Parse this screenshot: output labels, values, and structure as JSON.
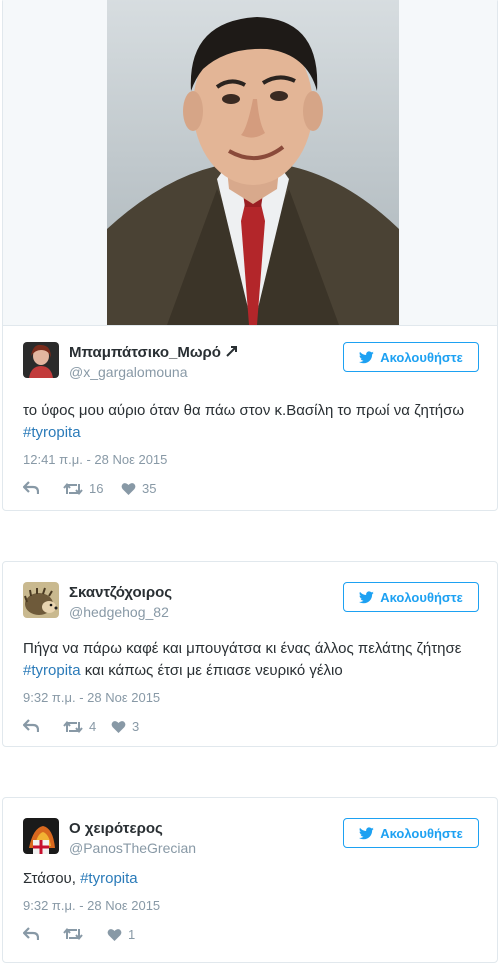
{
  "tweets": [
    {
      "name": "Μπαμπάτσικο_Μωρό",
      "name_icon": "arrow-icon",
      "handle": "@x_gargalomouna",
      "follow_label": "Ακολουθήστε",
      "text": "το ύφος μου αύριο όταν θα πάω στον κ.Βασίλη το πρωί να ζητήσω",
      "hashtag": "#tyropita",
      "text_after": "",
      "time": "12:41 π.μ. - 28 Νοε 2015",
      "retweets": "16",
      "likes": "35"
    },
    {
      "name": "Σκαντζόχοιρος",
      "handle": "@hedgehog_82",
      "follow_label": "Ακολουθήστε",
      "text": "Πήγα να πάρω καφέ και μπουγάτσα κι ένας άλλος πελάτης ζήτησε",
      "hashtag": "#tyropita",
      "text_after": "και κάπως έτσι με έπιασε νευρικό γέλιο",
      "time": "9:32 π.μ. - 28 Νοε 2015",
      "retweets": "4",
      "likes": "3"
    },
    {
      "name": "Ο χειρότερος",
      "handle": "@PanosTheGrecian",
      "follow_label": "Ακολουθήστε",
      "text": "Στάσου,",
      "hashtag": "#tyropita",
      "text_after": "",
      "time": "9:32 π.μ. - 28 Νοε 2015",
      "retweets": "",
      "likes": "1"
    }
  ],
  "colors": {
    "twitter_blue": "#1da1f2",
    "hashtag": "#2b7bb9",
    "muted": "#8899a6",
    "border": "#e1e8ed"
  }
}
